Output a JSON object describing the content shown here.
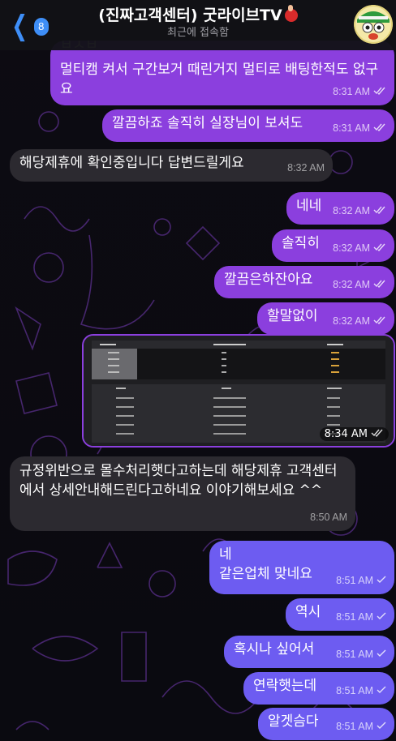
{
  "header": {
    "unread_count": "8",
    "title": "(진짜고객센터) 굿라이브TV",
    "status": "최근에 접속함"
  },
  "messages": [
    {
      "text_top": "ㅂㅅㅂ",
      "text": "멀티캠 켜서 구간보거 때린거지 멀티로 배팅한적도 없구요",
      "time": "8:31 AM"
    },
    {
      "text": "깔끔하죠 솔직히 실장님이 보셔도",
      "time": "8:31 AM"
    },
    {
      "text": "해당제휴에 확인중입니다 답변드릴게요",
      "time": "8:32 AM"
    },
    {
      "text": "네네",
      "time": "8:32 AM"
    },
    {
      "text": "솔직히",
      "time": "8:32 AM"
    },
    {
      "text": "깔끔은하잔아요",
      "time": "8:32 AM"
    },
    {
      "text": "할말없이",
      "time": "8:32 AM"
    },
    {
      "text": "",
      "time": "8:34 AM"
    },
    {
      "text": "규정위반으로 몰수처리햇다고하는데 해당제휴 고객센터에서 상세안내해드린다고하네요 이야기해보세요 ^^",
      "time": "8:50 AM"
    },
    {
      "text": "네\n같은업체 맞네요",
      "time": "8:51 AM"
    },
    {
      "text": "역시",
      "time": "8:51 AM"
    },
    {
      "text": "혹시나 싶어서",
      "time": "8:51 AM"
    },
    {
      "text": "연락햇는데",
      "time": "8:51 AM"
    },
    {
      "text": "알겟슴다",
      "time": "8:51 AM"
    }
  ],
  "colors": {
    "outgoing_purple": "#8b3fde",
    "outgoing_blue": "#6d5cf1",
    "incoming": "#2c2a30",
    "accent": "#3e8ef7"
  }
}
